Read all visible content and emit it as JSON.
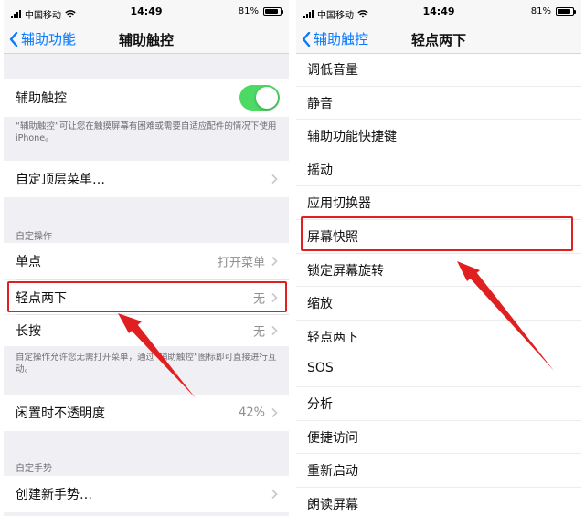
{
  "left": {
    "status": {
      "carrier": "中国移动",
      "time": "14:49",
      "battery": "81%"
    },
    "nav": {
      "back": "辅助功能",
      "title": "辅助触控"
    },
    "assistive_touch": {
      "label": "辅助触控",
      "on": true
    },
    "description": "“辅助触控”可让您在触摸屏幕有困难或需要自适应配件的情况下使用 iPhone。",
    "customize_top": "自定顶层菜单…",
    "custom_actions_header": "自定操作",
    "single_tap": {
      "label": "单点",
      "value": "打开菜单"
    },
    "double_tap": {
      "label": "轻点两下",
      "value": "无"
    },
    "long_press": {
      "label": "长按",
      "value": "无"
    },
    "actions_footer": "自定操作允许您无需打开菜单，通过“辅助触控”图标即可直接进行互动。",
    "idle_opacity": {
      "label": "闲置时不透明度",
      "value": "42%"
    },
    "custom_gestures_header": "自定手势",
    "create_gesture": "创建新手势…"
  },
  "right": {
    "status": {
      "carrier": "中国移动",
      "time": "14:49",
      "battery": "81%"
    },
    "nav": {
      "back": "辅助触控",
      "title": "轻点两下"
    },
    "items": [
      "调低音量",
      "静音",
      "辅助功能快捷键",
      "摇动",
      "应用切换器",
      "屏幕快照",
      "锁定屏幕旋转",
      "缩放",
      "轻点两下",
      "SOS",
      "分析",
      "便捷访问",
      "重新启动",
      "朗读屏幕"
    ]
  },
  "colors": {
    "accent": "#0a7aff",
    "toggle_on": "#4cd964",
    "highlight": "#e02020"
  }
}
